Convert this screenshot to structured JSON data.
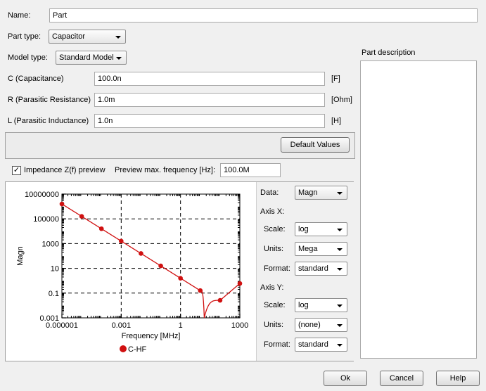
{
  "form": {
    "name_label": "Name:",
    "name_value": "Part",
    "part_type_label": "Part type:",
    "part_type_value": "Capacitor",
    "model_type_label": "Model type:",
    "model_type_value": "Standard Model",
    "params": [
      {
        "label": "C (Capacitance)",
        "value": "100.0n",
        "unit": "[F]"
      },
      {
        "label": "R (Parasitic Resistance)",
        "value": "1.0m",
        "unit": "[Ohm]"
      },
      {
        "label": "L (Parasitic Inductance)",
        "value": "1.0n",
        "unit": "[H]"
      }
    ],
    "default_values_button": "Default Values"
  },
  "description": {
    "label": "Part description",
    "value": ""
  },
  "preview": {
    "checkbox_label": "Impedance Z(f) preview",
    "checked": true,
    "max_freq_label": "Preview max. frequency [Hz]:",
    "max_freq_value": "100.0M"
  },
  "plot_settings": {
    "data_label": "Data:",
    "data_value": "Magn",
    "axis_x_label": "Axis X:",
    "axis_x": {
      "scale_label": "Scale:",
      "scale_value": "log",
      "units_label": "Units:",
      "units_value": "Mega",
      "format_label": "Format:",
      "format_value": "standard"
    },
    "axis_y_label": "Axis Y:",
    "axis_y": {
      "scale_label": "Scale:",
      "scale_value": "log",
      "units_label": "Units:",
      "units_value": "(none)",
      "format_label": "Format:",
      "format_value": "standard"
    }
  },
  "buttons": {
    "ok": "Ok",
    "cancel": "Cancel",
    "help": "Help"
  },
  "chart_data": {
    "type": "line",
    "xlabel": "Frequency [MHz]",
    "ylabel": "Magn",
    "xscale": "log",
    "yscale": "log",
    "xlim": [
      1e-06,
      1000
    ],
    "ylim": [
      0.001,
      10000000
    ],
    "x_ticks": [
      "0.000001",
      "0.001",
      "1",
      "1000"
    ],
    "y_ticks": [
      "0.001",
      "0.1",
      "10",
      "1000",
      "100000",
      "10000000"
    ],
    "grid": true,
    "legend": "bottom",
    "series": [
      {
        "name": "C-HF",
        "color": "#d01010",
        "markers": [
          {
            "x": 1e-06,
            "y": 1591549
          },
          {
            "x": 1e-05,
            "y": 159155
          },
          {
            "x": 0.0001,
            "y": 15915
          },
          {
            "x": 0.001,
            "y": 1592
          },
          {
            "x": 0.01,
            "y": 159
          },
          {
            "x": 0.1,
            "y": 15.9
          },
          {
            "x": 1,
            "y": 1.59
          },
          {
            "x": 10,
            "y": 0.16
          },
          {
            "x": 100,
            "y": 0.026
          },
          {
            "x": 1000,
            "y": 0.6
          }
        ],
        "resonance": {
          "x": 15.9,
          "y": 0.001
        }
      }
    ]
  }
}
